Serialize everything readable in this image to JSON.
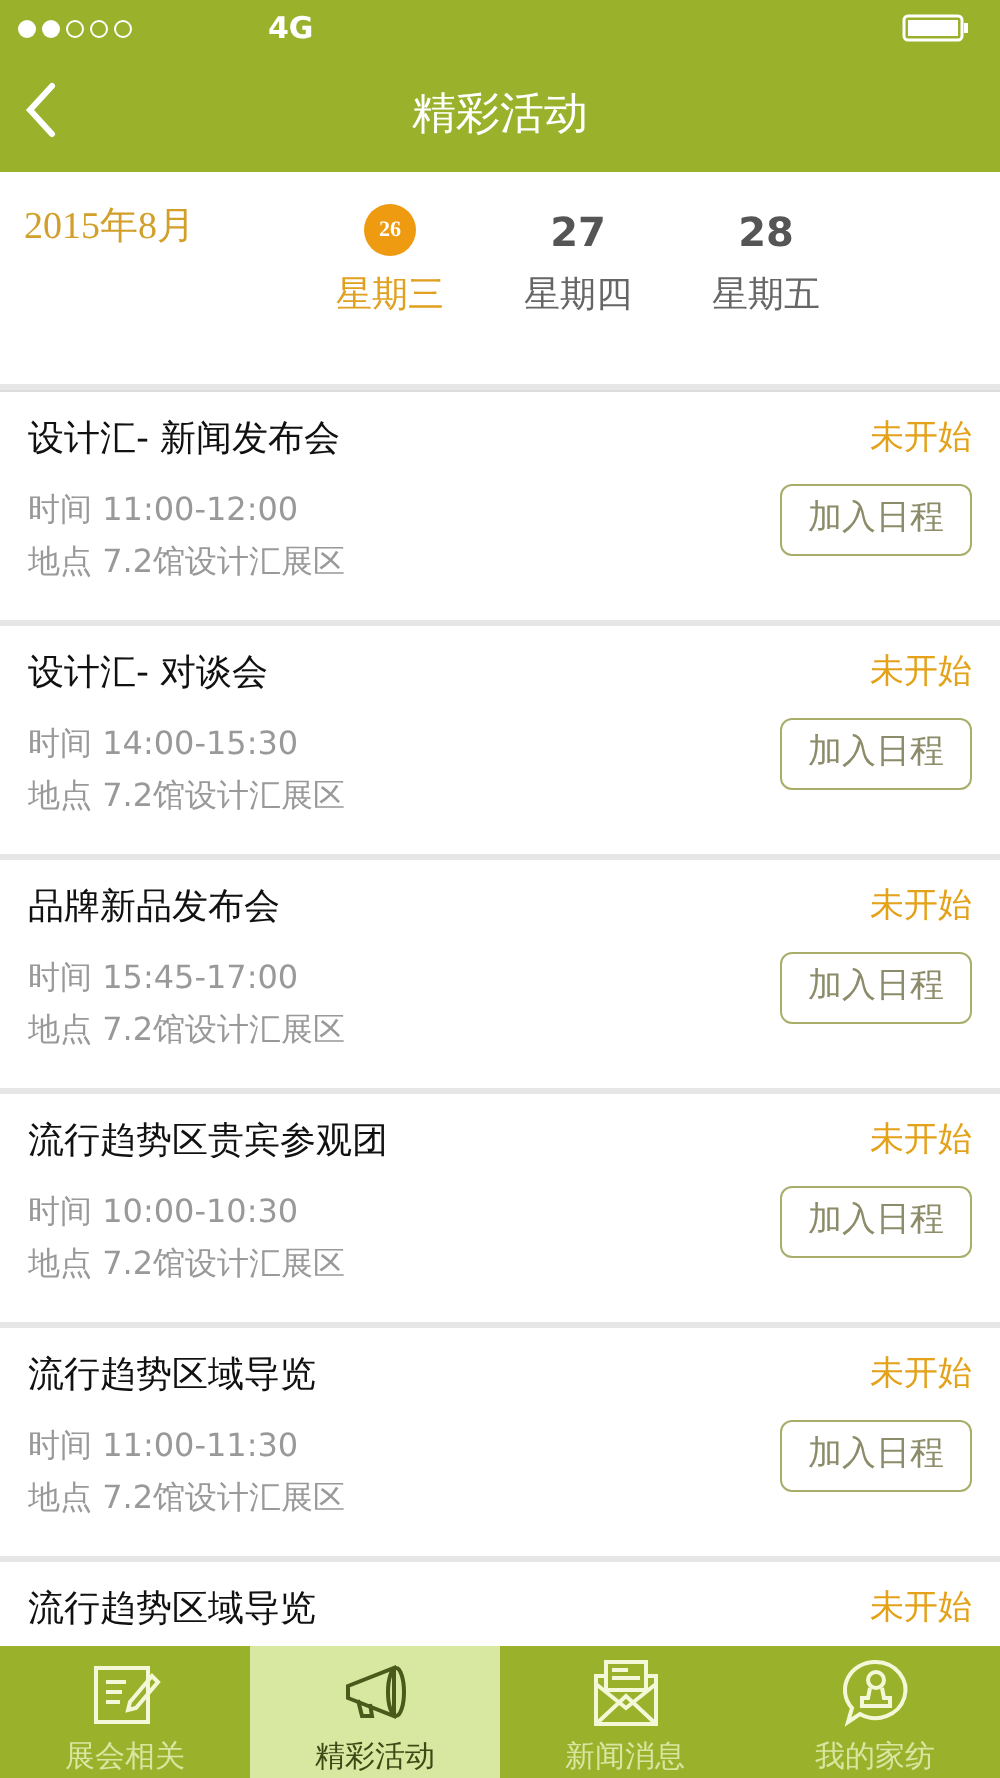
{
  "status_bar": {
    "network": "4G"
  },
  "nav": {
    "title": "精彩活动"
  },
  "date_header": {
    "month": "2015年8月",
    "days": [
      {
        "date": "26",
        "weekday": "星期三",
        "selected": true
      },
      {
        "date": "27",
        "weekday": "星期四",
        "selected": false
      },
      {
        "date": "28",
        "weekday": "星期五",
        "selected": false
      }
    ]
  },
  "events": [
    {
      "title": "设计汇- 新闻发布会",
      "status": "未开始",
      "time": "时间 11:00-12:00",
      "place": "地点 7.2馆设计汇展区",
      "button": "加入日程"
    },
    {
      "title": "设计汇- 对谈会",
      "status": "未开始",
      "time": "时间 14:00-15:30",
      "place": "地点 7.2馆设计汇展区",
      "button": "加入日程"
    },
    {
      "title": "品牌新品发布会",
      "status": "未开始",
      "time": "时间 15:45-17:00",
      "place": "地点 7.2馆设计汇展区",
      "button": "加入日程"
    },
    {
      "title": "流行趋势区贵宾参观团",
      "status": "未开始",
      "time": "时间 10:00-10:30",
      "place": "地点 7.2馆设计汇展区",
      "button": "加入日程"
    },
    {
      "title": "流行趋势区域导览",
      "status": "未开始",
      "time": "时间 11:00-11:30",
      "place": "地点 7.2馆设计汇展区",
      "button": "加入日程"
    },
    {
      "title": "流行趋势区域导览",
      "status": "未开始"
    }
  ],
  "tab_bar": [
    {
      "label": "展会相关",
      "selected": false
    },
    {
      "label": "精彩活动",
      "selected": true
    },
    {
      "label": "新闻消息",
      "selected": false
    },
    {
      "label": "我的家纺",
      "selected": false
    }
  ]
}
